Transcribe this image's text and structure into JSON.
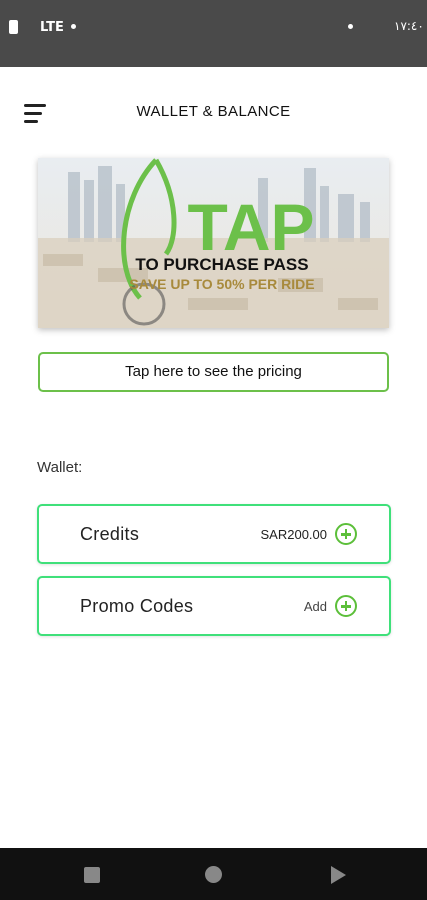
{
  "status_bar": {
    "network": "LTE",
    "clock": "١٧:٤٠"
  },
  "header": {
    "title": "WALLET & BALANCE"
  },
  "banner": {
    "headline": "TAP",
    "line1": "TO PURCHASE PASS",
    "line2": "SAVE UP TO 50% PER RIDE"
  },
  "pricing_button": {
    "label": "Tap here to see the pricing"
  },
  "wallet": {
    "label": "Wallet:",
    "items": [
      {
        "label": "Credits",
        "value": "SAR200.00"
      },
      {
        "label": "Promo Codes",
        "value": "Add"
      }
    ]
  },
  "colors": {
    "accent_green": "#6cc04a",
    "card_border": "#3fe07a",
    "status_bar": "#4a4a4a",
    "nav_bar": "#111111"
  },
  "icons": {
    "menu": "hamburger-icon",
    "add": "plus-circle-icon"
  }
}
